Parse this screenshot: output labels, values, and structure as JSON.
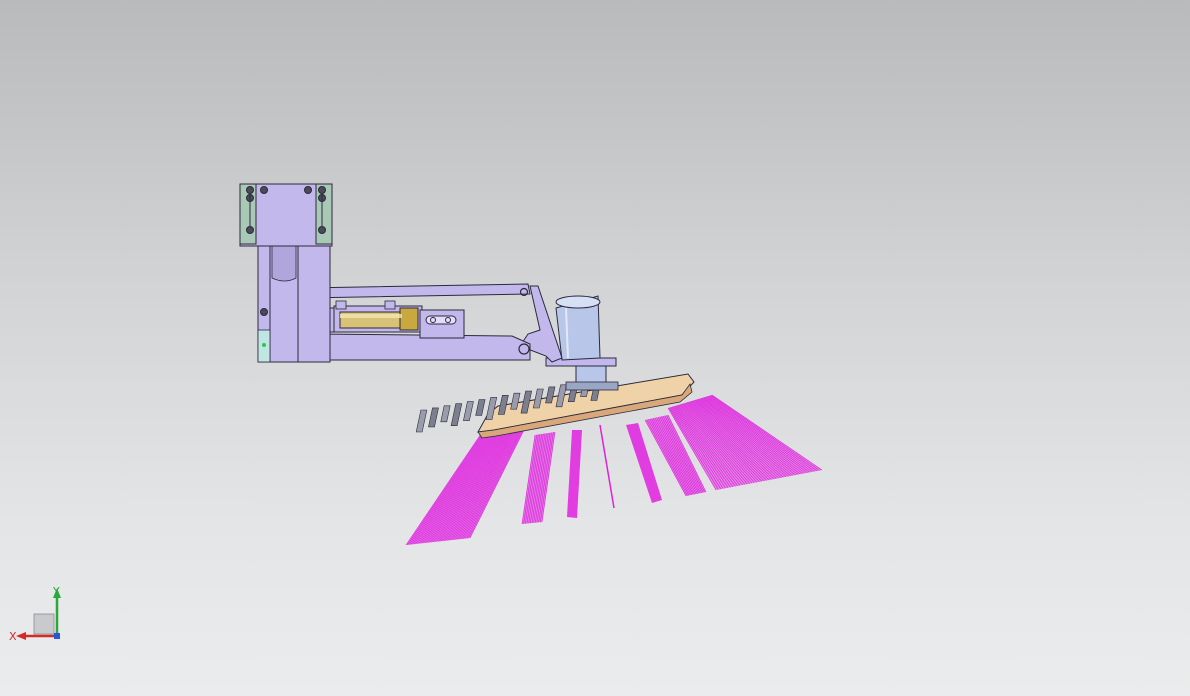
{
  "viewport": {
    "background_top": "#b9babc",
    "background_bottom": "#ebeced"
  },
  "model": {
    "part_color": "#c3b8ec",
    "edge_color": "#2c2a3c",
    "mount_plate_color": "#a9c9b6",
    "cylinder_color": "#d8c278",
    "motor_color": "#b8c6ea",
    "brush_disc_color": "#efd2a8",
    "bristle_color": "#e020e0"
  },
  "triad": {
    "x_label": "X",
    "y_label": "Y",
    "x_color": "#d42a2a",
    "y_color": "#2aa83a",
    "z_color": "#2a56d4",
    "icon": "coordinate-triad-icon"
  }
}
